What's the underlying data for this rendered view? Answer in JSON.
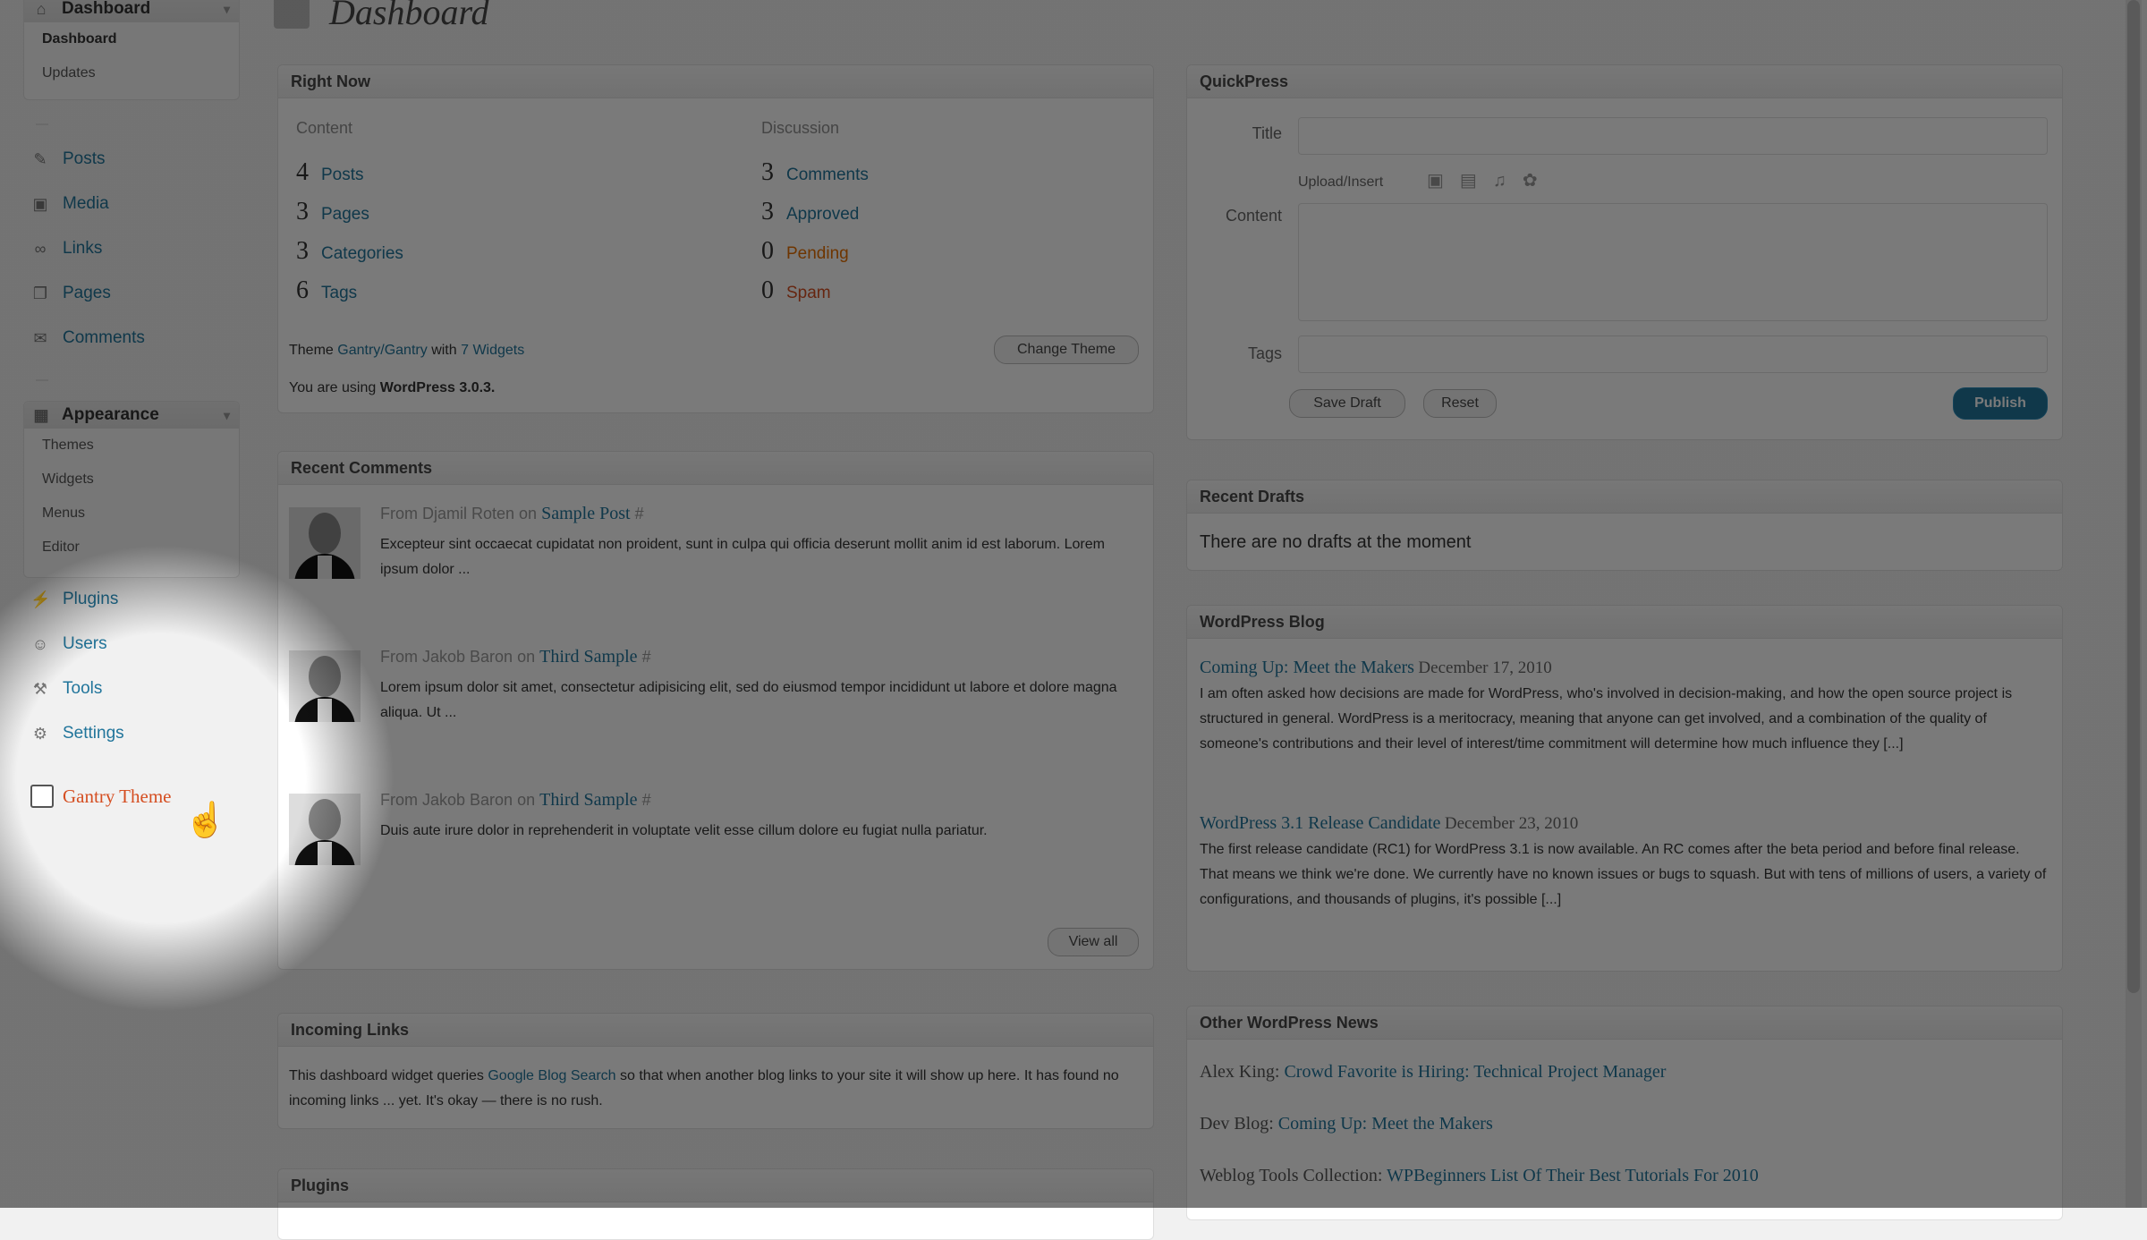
{
  "sidebar": {
    "dashboard_group": {
      "label": "Dashboard",
      "subitems": [
        "Dashboard",
        "Updates"
      ]
    },
    "items": [
      {
        "label": "Posts",
        "icon": "pin-icon"
      },
      {
        "label": "Media",
        "icon": "media-icon"
      },
      {
        "label": "Links",
        "icon": "link-icon"
      },
      {
        "label": "Pages",
        "icon": "pages-icon"
      },
      {
        "label": "Comments",
        "icon": "comments-icon"
      }
    ],
    "appearance_group": {
      "label": "Appearance",
      "subitems": [
        "Themes",
        "Widgets",
        "Menus",
        "Editor"
      ]
    },
    "items2": [
      {
        "label": "Plugins",
        "icon": "plugin-icon"
      },
      {
        "label": "Users",
        "icon": "users-icon"
      },
      {
        "label": "Tools",
        "icon": "tools-icon"
      },
      {
        "label": "Settings",
        "icon": "settings-icon"
      }
    ],
    "gantry": {
      "label": "Gantry Theme",
      "color": "#d54e21"
    }
  },
  "page": {
    "title": "Dashboard"
  },
  "right_now": {
    "title": "Right Now",
    "content_heading": "Content",
    "discussion_heading": "Discussion",
    "content": [
      {
        "n": "4",
        "label": "Posts"
      },
      {
        "n": "3",
        "label": "Pages"
      },
      {
        "n": "3",
        "label": "Categories"
      },
      {
        "n": "6",
        "label": "Tags"
      }
    ],
    "discussion": [
      {
        "n": "3",
        "label": "Comments"
      },
      {
        "n": "3",
        "label": "Approved"
      },
      {
        "n": "0",
        "label": "Pending"
      },
      {
        "n": "0",
        "label": "Spam"
      }
    ],
    "theme_prefix": "Theme",
    "theme_name": "Gantry/Gantry",
    "theme_with": "with",
    "widgets_link": "7 Widgets",
    "change_theme": "Change Theme",
    "version_prefix": "You are using",
    "version": "WordPress 3.0.3."
  },
  "recent_comments": {
    "title": "Recent Comments",
    "items": [
      {
        "author": "From Djamil Roten",
        "on": "on",
        "post": "Sample Post",
        "text": "Excepteur sint occaecat cupidatat non proident, sunt in culpa qui officia deserunt mollit anim id est laborum. Lorem ipsum dolor ..."
      },
      {
        "author": "From Jakob Baron",
        "on": "on",
        "post": "Third Sample",
        "text": "Lorem ipsum dolor sit amet, consectetur adipisicing elit, sed do eiusmod tempor incididunt ut labore et dolore magna aliqua. Ut ..."
      },
      {
        "author": "From Jakob Baron",
        "on": "on",
        "post": "Third Sample",
        "text": "Duis aute irure dolor in reprehenderit in voluptate velit esse cillum dolore eu fugiat nulla pariatur."
      }
    ],
    "view_all": "View all"
  },
  "incoming_links": {
    "title": "Incoming Links",
    "text_a": "This dashboard widget queries",
    "link": "Google Blog Search",
    "text_b": "so that when another blog links to your site it will show up here. It has found no incoming links ... yet. It's okay — there is no rush."
  },
  "plugins": {
    "title": "Plugins"
  },
  "quickpress": {
    "title": "QuickPress",
    "title_label": "Title",
    "upload_label": "Upload/Insert",
    "content_label": "Content",
    "tags_label": "Tags",
    "save_draft": "Save Draft",
    "reset": "Reset",
    "publish": "Publish"
  },
  "recent_drafts": {
    "title": "Recent Drafts",
    "empty": "There are no drafts at the moment"
  },
  "wp_blog": {
    "title": "WordPress Blog",
    "posts": [
      {
        "title": "Coming Up: Meet the Makers",
        "date": "December 17, 2010",
        "text": "I am often asked how decisions are made for WordPress, who's involved in decision-making, and how the open source project is structured in general. WordPress is a meritocracy, meaning that anyone can get involved, and a combination of the quality of someone's contributions and their level of interest/time commitment will determine how much influence they [...]"
      },
      {
        "title": "WordPress 3.1 Release Candidate",
        "date": "December 23, 2010",
        "text": "The first release candidate (RC1) for WordPress 3.1 is now available. An RC comes after the beta period and before final release. That means we think we're done. We currently have no known issues or bugs to squash. But with tens of millions of users, a variety of configurations, and thousands of plugins, it's possible [...]"
      }
    ]
  },
  "other_news": {
    "title": "Other WordPress News",
    "items": [
      {
        "src": "Alex King:",
        "title": "Crowd Favorite is Hiring: Technical Project Manager"
      },
      {
        "src": "Dev Blog:",
        "title": "Coming Up: Meet the Makers"
      },
      {
        "src": "Weblog Tools Collection:",
        "title": "WPBeginners List Of Their Best Tutorials For 2010"
      }
    ]
  }
}
